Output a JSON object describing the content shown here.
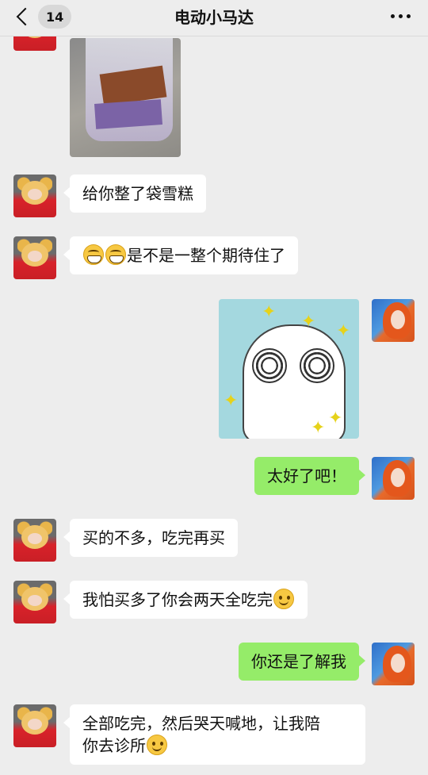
{
  "header": {
    "back_count": "14",
    "title": "电动小马达"
  },
  "messages": [
    {
      "side": "left",
      "text": "给你整了袋雪糕"
    },
    {
      "side": "left",
      "text": "是不是一整个期待住了",
      "prefix_icons": [
        "grinning-face-icon",
        "grinning-face-icon"
      ]
    },
    {
      "side": "right",
      "text": "太好了吧！"
    },
    {
      "side": "left",
      "text": "买的不多，吃完再买"
    },
    {
      "side": "left",
      "text": "我怕买多了你会两天全吃完",
      "suffix_icon": "smiling-face-icon"
    },
    {
      "side": "right",
      "text": "你还是了解我"
    },
    {
      "side": "left",
      "text_line1": "全部吃完，然后哭天喊地，让我陪",
      "text_line2": "你去诊所",
      "suffix_icon": "smiling-face-icon"
    }
  ],
  "colors": {
    "background": "#ededed",
    "left_bubble": "#ffffff",
    "right_bubble": "#95ec69"
  }
}
